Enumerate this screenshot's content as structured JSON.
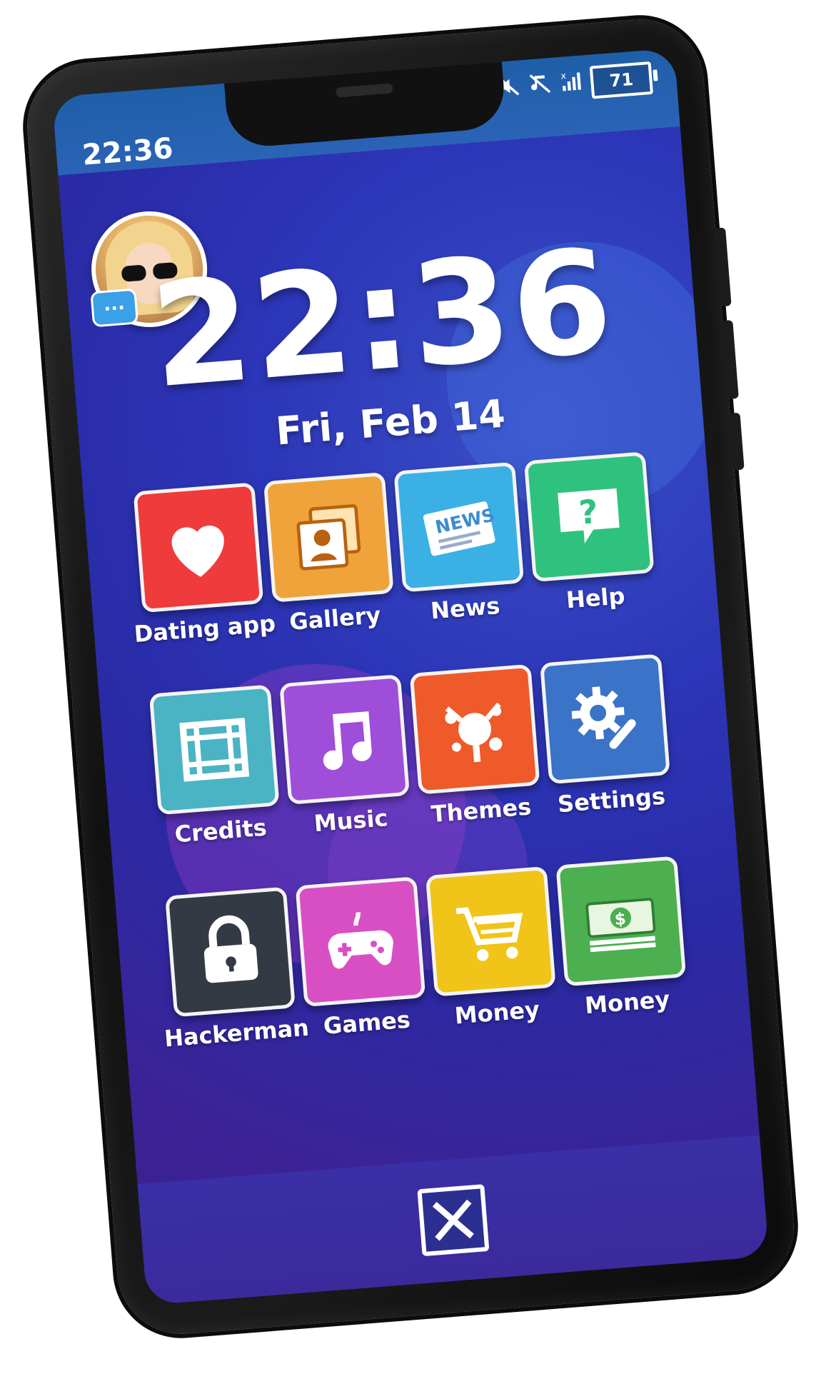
{
  "status_bar": {
    "time": "22:36",
    "battery": "71",
    "icons": [
      "mute-icon",
      "no-vibrate-icon",
      "no-signal-icon",
      "battery-icon"
    ]
  },
  "lock": {
    "time": "22:36",
    "date": "Fri, Feb 14"
  },
  "contact": {
    "chat_badge": "..."
  },
  "apps": [
    {
      "label": "Dating app",
      "icon": "heart-icon",
      "color": "#ef3b3b"
    },
    {
      "label": "Gallery",
      "icon": "gallery-icon",
      "color": "#f0a33a"
    },
    {
      "label": "News",
      "icon": "news-icon",
      "color": "#3bb0e4"
    },
    {
      "label": "Help",
      "icon": "help-icon",
      "color": "#2ec27e"
    },
    {
      "label": "Credits",
      "icon": "film-icon",
      "color": "#4ab3c4"
    },
    {
      "label": "Music",
      "icon": "music-note-icon",
      "color": "#9e4ed8"
    },
    {
      "label": "Themes",
      "icon": "paint-splash-icon",
      "color": "#ef5a2a"
    },
    {
      "label": "Settings",
      "icon": "gear-wrench-icon",
      "color": "#3a73c7"
    },
    {
      "label": "Hackerman",
      "icon": "lock-icon",
      "color": "#333a44"
    },
    {
      "label": "Games",
      "icon": "gamepad-icon",
      "color": "#d84fc4"
    },
    {
      "label": "Money",
      "icon": "cart-icon",
      "color": "#f0c419"
    },
    {
      "label": "Money",
      "icon": "cash-icon",
      "color": "#4caf50"
    }
  ],
  "bottom": {
    "close_icon": "close-icon"
  }
}
